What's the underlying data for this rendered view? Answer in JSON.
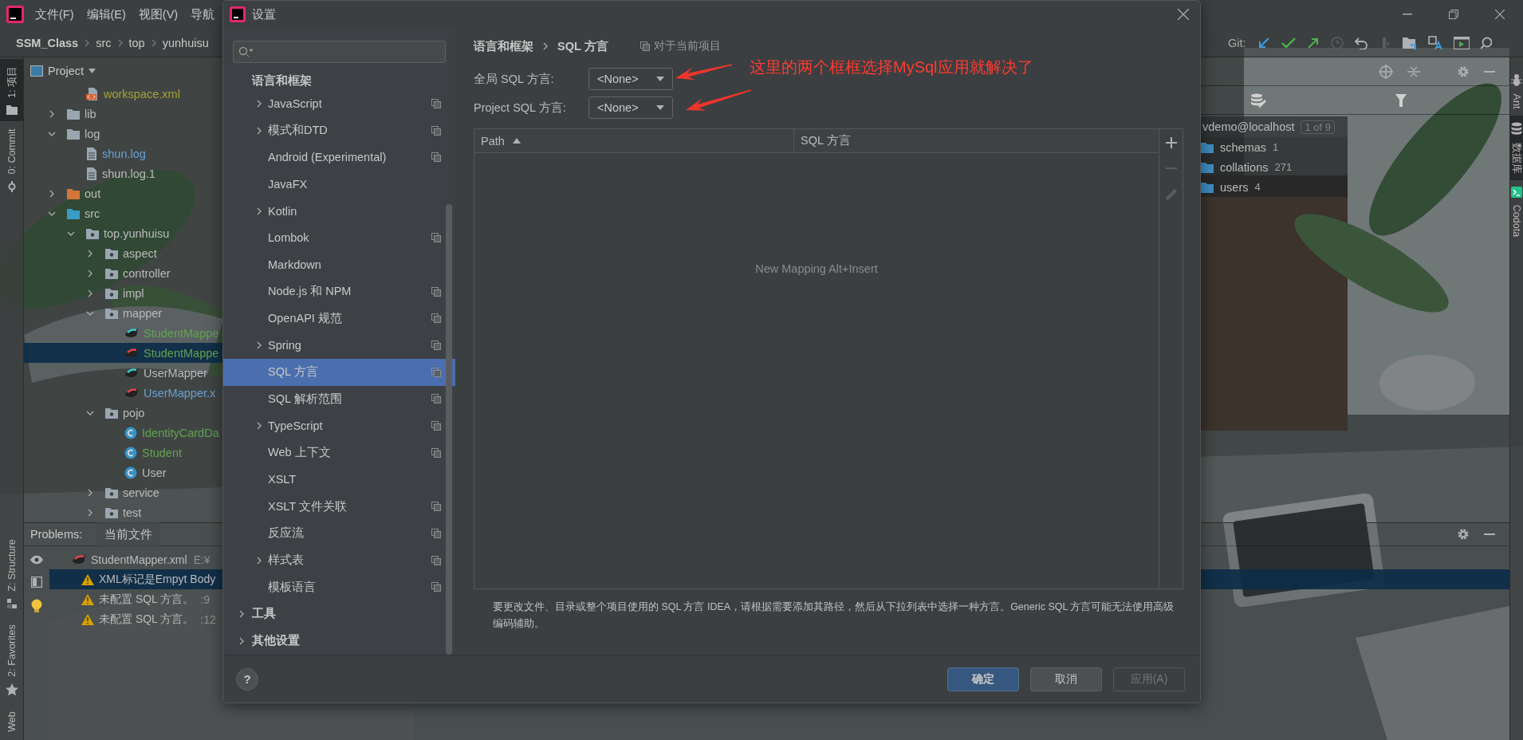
{
  "menu_bar": {
    "items": [
      "文件(F)",
      "编辑(E)",
      "视图(V)",
      "导航"
    ]
  },
  "navigation_bar": {
    "breadcrumb": [
      {
        "label": "SSM_Class",
        "kind": "project"
      },
      {
        "label": "src",
        "kind": "folder"
      },
      {
        "label": "top",
        "kind": "folder"
      },
      {
        "label": "yunhuisu",
        "kind": "folder"
      }
    ],
    "vcs_label": "Git:"
  },
  "left_tool_strip": {
    "top": [
      {
        "label": "1: 项目",
        "kind": "project",
        "selected": true
      },
      {
        "label": "0: Commit",
        "kind": "commit",
        "selected": false
      }
    ],
    "bottom": [
      {
        "label": "Z: Structure",
        "kind": "structure",
        "selected": false
      },
      {
        "label": "2: Favorites",
        "kind": "favorites",
        "selected": false
      },
      {
        "label": "Web",
        "kind": "web",
        "selected": false
      }
    ]
  },
  "project_panel": {
    "title": "Project",
    "partial_row": {
      "label": "workspace.xml",
      "kind": "xml",
      "color": "#a8a236",
      "selected": false
    },
    "tree": [
      {
        "label": "lib",
        "kind": "folder",
        "color": "#bbbbbb",
        "expanded": false,
        "selected": false
      },
      {
        "label": "log",
        "kind": "folder",
        "color": "#bbbbbb",
        "expanded": true,
        "selected": false,
        "children": [
          {
            "label": "shun.log",
            "kind": "text",
            "color": "#6a9fd4",
            "selected": false
          },
          {
            "label": "shun.log.1",
            "kind": "text",
            "color": "#bbbbbb",
            "selected": false
          }
        ]
      },
      {
        "label": "out",
        "kind": "excluded",
        "color": "#bbbbbb",
        "expanded": false,
        "selected": false
      },
      {
        "label": "src",
        "kind": "source",
        "color": "#bbbbbb",
        "expanded": true,
        "selected": false,
        "children": [
          {
            "label": "top.yunhuisu",
            "kind": "package",
            "color": "#bbbbbb",
            "expanded": true,
            "selected": false,
            "children": [
              {
                "label": "aspect",
                "kind": "package",
                "color": "#bbbbbb",
                "expanded": false,
                "selected": false
              },
              {
                "label": "controller",
                "kind": "package",
                "color": "#bbbbbb",
                "expanded": false,
                "selected": false
              },
              {
                "label": "impl",
                "kind": "package",
                "color": "#bbbbbb",
                "expanded": false,
                "selected": false
              },
              {
                "label": "mapper",
                "kind": "package",
                "color": "#bbbbbb",
                "expanded": true,
                "selected": false,
                "children": [
                  {
                    "label": "StudentMappe",
                    "kind": "mapper",
                    "color": "#62a350",
                    "selected": false
                  },
                  {
                    "label": "StudentMappe",
                    "kind": "mapper-xml",
                    "color": "#62a350",
                    "selected": true
                  },
                  {
                    "label": "UserMapper",
                    "kind": "mapper",
                    "color": "#bbbbbb",
                    "selected": false
                  },
                  {
                    "label": "UserMapper.x",
                    "kind": "mapper-xml",
                    "color": "#6a9fd4",
                    "selected": false
                  }
                ]
              },
              {
                "label": "pojo",
                "kind": "package",
                "color": "#bbbbbb",
                "expanded": true,
                "selected": false,
                "children": [
                  {
                    "label": "IdentityCardDa",
                    "kind": "class",
                    "color": "#62a350",
                    "selected": false
                  },
                  {
                    "label": "Student",
                    "kind": "class",
                    "color": "#62a350",
                    "selected": false
                  },
                  {
                    "label": "User",
                    "kind": "class",
                    "color": "#bbbbbb",
                    "selected": false
                  }
                ]
              },
              {
                "label": "service",
                "kind": "package",
                "color": "#bbbbbb",
                "expanded": false,
                "selected": false
              },
              {
                "label": "test",
                "kind": "package",
                "color": "#bbbbbb",
                "expanded": false,
                "selected": false
              }
            ]
          }
        ]
      }
    ]
  },
  "problems_panel": {
    "title": "Problems:",
    "tabs": [
      {
        "label": "当前文件",
        "selected": true
      }
    ],
    "rows": [
      {
        "kind": "file",
        "text": "StudentMapper.xml",
        "location": "E:¥",
        "selected": false,
        "children": [
          {
            "kind": "warning",
            "text": "XML标记是Empyt Body",
            "selected": true
          },
          {
            "kind": "warning",
            "text": "未配置 SQL 方言。",
            "location": ":9",
            "selected": false
          },
          {
            "kind": "warning",
            "text": "未配置 SQL 方言。",
            "location": ":12",
            "selected": false
          }
        ]
      }
    ]
  },
  "database_panel": {
    "connection": {
      "label": "vdemo@localhost",
      "badge": "1 of 9"
    },
    "tree": [
      {
        "label": "schemas",
        "count": "1"
      },
      {
        "label": "collations",
        "count": "271"
      },
      {
        "label": "users",
        "count": "4"
      }
    ]
  },
  "right_tool_strip": [
    {
      "label": "Ant",
      "kind": "ant",
      "selected": false
    },
    {
      "label": "数据库",
      "kind": "database",
      "selected": true
    },
    {
      "label": "Codota",
      "kind": "codota",
      "selected": false
    }
  ],
  "settings_dialog": {
    "title": "设置",
    "tree": [
      {
        "label": "语言和框架",
        "expandable": false,
        "selected": false,
        "children": [
          {
            "label": "JavaScript",
            "expandable": true,
            "project_level": true,
            "selected": false
          },
          {
            "label": "模式和DTD",
            "expandable": true,
            "project_level": true,
            "selected": false
          },
          {
            "label": "Android (Experimental)",
            "expandable": false,
            "project_level": true,
            "selected": false
          },
          {
            "label": "JavaFX",
            "expandable": false,
            "project_level": false,
            "selected": false
          },
          {
            "label": "Kotlin",
            "expandable": true,
            "project_level": false,
            "selected": false
          },
          {
            "label": "Lombok",
            "expandable": false,
            "project_level": true,
            "selected": false
          },
          {
            "label": "Markdown",
            "expandable": false,
            "project_level": false,
            "selected": false
          },
          {
            "label": "Node.js 和 NPM",
            "expandable": false,
            "project_level": true,
            "selected": false
          },
          {
            "label": "OpenAPI 规范",
            "expandable": false,
            "project_level": true,
            "selected": false
          },
          {
            "label": "Spring",
            "expandable": true,
            "project_level": true,
            "selected": false
          },
          {
            "label": "SQL 方言",
            "expandable": false,
            "project_level": true,
            "selected": true
          },
          {
            "label": "SQL 解析范围",
            "expandable": false,
            "project_level": true,
            "selected": false
          },
          {
            "label": "TypeScript",
            "expandable": true,
            "project_level": true,
            "selected": false
          },
          {
            "label": "Web 上下文",
            "expandable": false,
            "project_level": true,
            "selected": false
          },
          {
            "label": "XSLT",
            "expandable": false,
            "project_level": false,
            "selected": false
          },
          {
            "label": "XSLT 文件关联",
            "expandable": false,
            "project_level": true,
            "selected": false
          },
          {
            "label": "反应流",
            "expandable": false,
            "project_level": true,
            "selected": false
          },
          {
            "label": "样式表",
            "expandable": true,
            "project_level": true,
            "selected": false
          },
          {
            "label": "模板语言",
            "expandable": false,
            "project_level": true,
            "selected": false
          }
        ]
      },
      {
        "label": "工具",
        "expandable": true,
        "selected": false
      },
      {
        "label": "其他设置",
        "expandable": true,
        "selected": false
      }
    ],
    "breadcrumb": [
      "语言和框架",
      "SQL 方言"
    ],
    "scope": "对于当前项目",
    "fields": [
      {
        "label": "全局 SQL 方言:",
        "value": "<None>"
      },
      {
        "label": "Project SQL 方言:",
        "value": "<None>"
      }
    ],
    "table": {
      "columns": [
        {
          "label": "Path",
          "sorted": true
        },
        {
          "label": "SQL 方言",
          "sorted": false
        }
      ],
      "empty_text": "New Mapping Alt+Insert",
      "tools": [
        {
          "kind": "add",
          "disabled": false
        },
        {
          "kind": "remove",
          "disabled": true
        },
        {
          "kind": "edit",
          "disabled": true
        }
      ]
    },
    "description": "要更改文件、目录或整个项目使用的 SQL 方言 IDEA，请根据需要添加其路径，然后从下拉列表中选择一种方言。Generic SQL 方言可能无法使用高级编码辅助。",
    "help_button": "?",
    "buttons": [
      {
        "label": "确定",
        "kind": "primary",
        "disabled": false
      },
      {
        "label": "取消",
        "kind": "normal",
        "disabled": false
      },
      {
        "label": "应用(A)",
        "kind": "normal",
        "disabled": true
      }
    ]
  },
  "annotation": {
    "text": "这里的两个框框选择MySql应用就解决了"
  }
}
